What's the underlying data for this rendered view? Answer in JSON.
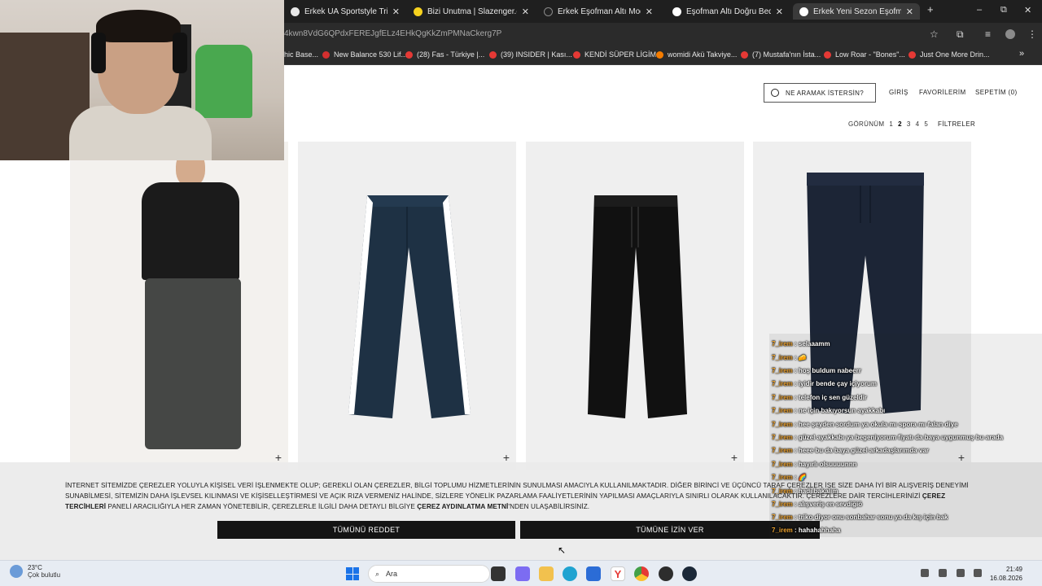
{
  "browser": {
    "tabs": [
      {
        "title": "Erkek UA Sportstyle Triko Eşofman",
        "favicon_color": "#e8e8e8",
        "active": false
      },
      {
        "title": "Bizi Unutma | Slazenger.com.tr",
        "favicon_color": "#f7d21e",
        "active": false
      },
      {
        "title": "Erkek Eşofman Altı Modelleri | C",
        "favicon_color": "#222222",
        "active": false
      },
      {
        "title": "Eşofman Altı Doğru Beden Seçi",
        "favicon_color": "#ffffff",
        "active": false
      },
      {
        "title": "Erkek Yeni Sezon Eşofman Altı",
        "favicon_color": "#ffffff",
        "active": true
      }
    ],
    "new_tab": "+",
    "window_controls": {
      "minimize": "–",
      "maximize": "⧉",
      "close": "✕"
    },
    "url": "4kwn8VdG6QPdxFEREJgfELz4EHkQgKkZmPMNaCkerg7P",
    "bookmarks": [
      {
        "label": "hic Base...",
        "color": "#888888"
      },
      {
        "label": "New Balance 530 Lif...",
        "color": "#d32f2f"
      },
      {
        "label": "(28) Fas - Türkiye |...",
        "color": "#e53935"
      },
      {
        "label": "(39) INSIDER | Kası...",
        "color": "#e53935"
      },
      {
        "label": "KENDİ SÜPER LİGİM...",
        "color": "#e53935"
      },
      {
        "label": "womidi Akü Takviye...",
        "color": "#f57c00"
      },
      {
        "label": "(7) Mustafa'nın İsta...",
        "color": "#e53935"
      },
      {
        "label": "Low Roar - \"Bones\"...",
        "color": "#e53935"
      },
      {
        "label": "Just One More Drin...",
        "color": "#e53935"
      }
    ],
    "bookmark_more": "»"
  },
  "site": {
    "search_placeholder": "NE ARAMAK İSTERSİN?",
    "nav": {
      "login": "GİRİŞ",
      "favorites": "FAVORİLERİM",
      "cart": "SEPETİM (0)"
    },
    "view": {
      "label": "GÖRÜNÜM",
      "options": [
        "1",
        "2",
        "3",
        "4",
        "5"
      ],
      "current": "2"
    },
    "filters_label": "FİLTRELER",
    "products": [
      {
        "kind": "model",
        "pants_color": "#454745"
      },
      {
        "kind": "pants",
        "pants_color": "#1e3144",
        "stripe_color": "#ffffff"
      },
      {
        "kind": "pants",
        "pants_color": "#111111"
      },
      {
        "kind": "pants",
        "pants_color": "#1c2536"
      }
    ],
    "add_icon": "+"
  },
  "cookie_banner": {
    "text_part1": "İNTERNET SİTEMİZDE ÇEREZLER YOLUYLA KİŞİSEL VERİ İŞLENMEKTE OLUP; GEREKLİ OLAN ÇEREZLER, BİLGİ TOPLUMU HİZMETLERİNİN SUNULMASI AMACIYLA KULLANILMAKTADIR. DİĞER BİRİNCİ VE ÜÇÜNCÜ TARAF ÇEREZLER İSE SİZE DAHA İYİ BİR ALIŞVERİŞ DENEYİMİ SUNABİLMESİ, SİTEMİZİN DAHA İŞLEVSEL KILINMASI VE KİŞİSELLEŞTİRMESİ VE AÇIK RIZA VERMENİZ HALİNDE, SİZLERE YÖNELİK PAZARLAMA FAALİYETLERİNİN YAPILMASI AMAÇLARIYLA SINIRLI OLARAK KULLANILACAKTIR. ÇEREZLERE DAİR TERCİHLERİNİZİ",
    "link1": "ÇEREZ TERCİHLERİ",
    "text_part2": "PANELİ ARACILIĞIYLA HER ZAMAN YÖNETEBİLİR, ÇEREZLERLE İLGİLİ DAHA DETAYLI BİLGİYE",
    "link2": "ÇEREZ AYDINLATMA METNİ",
    "text_part3": "'NDEN ULAŞABİLİRSİNİZ.",
    "reject_label": "TÜMÜNÜ REDDET",
    "accept_label": "TÜMÜNE İZİN VER"
  },
  "chat": {
    "username": "7_irem",
    "messages": [
      "selaaamm",
      "🧀",
      "hoş buldum nabeerr",
      "iyidir bende çay içiyorum",
      "telefon iç sen güzeldir",
      "ne için bakıyorsun ayakkabı",
      "hee şeyden sordum ya okula mı spora mı falan diye",
      "güzel ayakkabı ya begeniyorum fiyatı da baya uygunmuş bu arada",
      "heee bu da baya güzel arkadaşlarımda var",
      "hayırlı olsuuuunnn",
      "🌈",
      "hadi bakalım",
      "alışveriş en sevdiğiö",
      "triko diyor onu sonbahar sonu ya da kış için bak",
      "hahahahhaha"
    ]
  },
  "taskbar": {
    "weather_temp": "23°C",
    "weather_desc": "Çok bulutlu",
    "search_label": "Ara",
    "time": "21:49",
    "date": "16.08.2026",
    "apps": [
      {
        "name": "file-explorer-app",
        "color": "#f2c14e"
      },
      {
        "name": "edge-app",
        "color": "#1fa3d1"
      },
      {
        "name": "store-app",
        "color": "#2b6cd6"
      },
      {
        "name": "yandex-app",
        "color": "#ffffff"
      },
      {
        "name": "chrome-app",
        "color": "#4caf50"
      },
      {
        "name": "steam-app",
        "color": "#1b2838"
      }
    ]
  }
}
